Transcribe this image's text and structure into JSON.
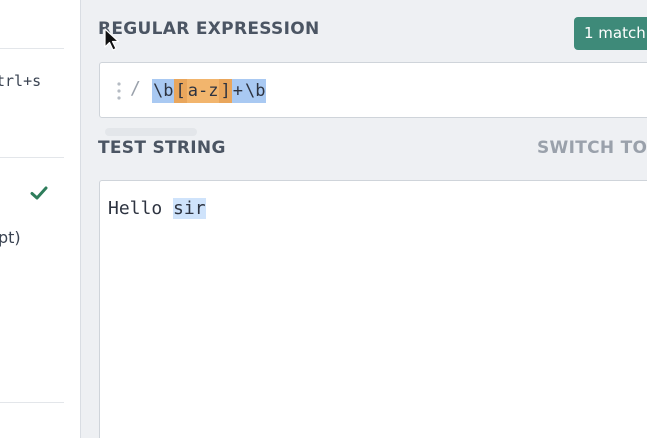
{
  "sidebar": {
    "save_shortcut": "trl+s",
    "flavor_suffix": "pt)",
    "check_icon": "check-icon"
  },
  "regex_section": {
    "title": "REGULAR EXPRESSION",
    "match_count": "1 match",
    "delimiter": "/",
    "tokens": {
      "t1": "\\b",
      "t2": "[",
      "t3": "a-z",
      "t4": "]",
      "t5": "+",
      "t6": "\\b"
    }
  },
  "test_section": {
    "title": "TEST STRING",
    "switch_label": "SWITCH TO",
    "text_before": "Hello ",
    "text_match": "sir"
  },
  "colors": {
    "match_badge": "#3e8a79",
    "regex_highlight": "#a9c9f2",
    "char_class": "#f2b56d",
    "match_highlight": "#cfe3fb",
    "check": "#2e7d5b"
  }
}
